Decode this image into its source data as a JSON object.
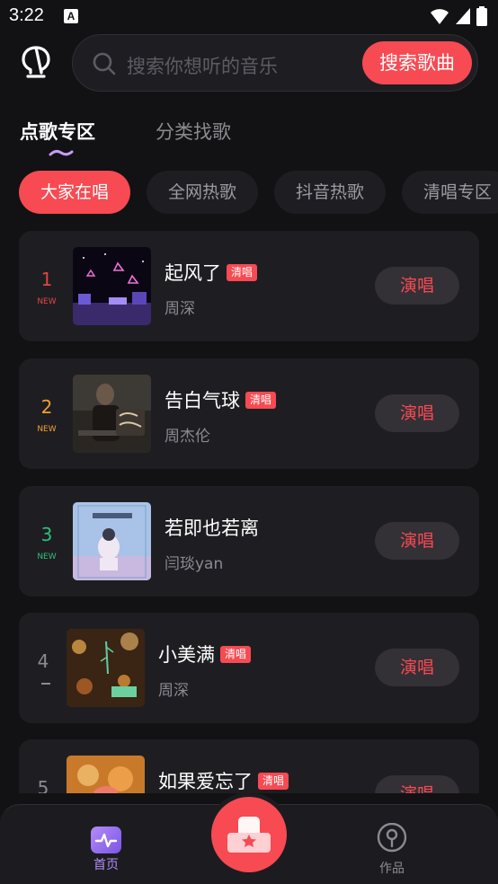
{
  "status": {
    "time": "3:22",
    "notification_letter": "A"
  },
  "search": {
    "placeholder": "搜索你想听的音乐",
    "button_label": "搜索歌曲"
  },
  "tabs": [
    {
      "label": "点歌专区",
      "active": true
    },
    {
      "label": "分类找歌",
      "active": false
    }
  ],
  "chips": [
    {
      "label": "大家在唱",
      "active": true
    },
    {
      "label": "全网热歌",
      "active": false
    },
    {
      "label": "抖音热歌",
      "active": false
    },
    {
      "label": "清唱专区",
      "active": false
    }
  ],
  "songs": [
    {
      "rank": "1",
      "rank_tag": "NEW",
      "rank_color": "#e0453f",
      "title": "起风了",
      "badge": "清唱",
      "artist": "周深",
      "action": "演唱"
    },
    {
      "rank": "2",
      "rank_tag": "NEW",
      "rank_color": "#f0a030",
      "title": "告白气球",
      "badge": "清唱",
      "artist": "周杰伦",
      "action": "演唱"
    },
    {
      "rank": "3",
      "rank_tag": "NEW",
      "rank_color": "#2fbf7a",
      "title": "若即也若离",
      "badge": "",
      "artist": "闫琰yan",
      "action": "演唱"
    },
    {
      "rank": "4",
      "rank_tag": "",
      "rank_color": "#8a8a91",
      "title": "小美满",
      "badge": "清唱",
      "artist": "周深",
      "action": "演唱"
    },
    {
      "rank": "5",
      "rank_tag": "",
      "rank_color": "#8a8a91",
      "title": "如果爱忘了",
      "badge": "清唱",
      "artist": "",
      "action": "演唱"
    }
  ],
  "bottom_nav": {
    "home_label": "首页",
    "works_label": "作品",
    "home_color": "#b38cf7",
    "works_color": "#8a8a91"
  },
  "colors": {
    "accent": "#f74a52",
    "background": "#121214",
    "card": "#1e1e22"
  }
}
